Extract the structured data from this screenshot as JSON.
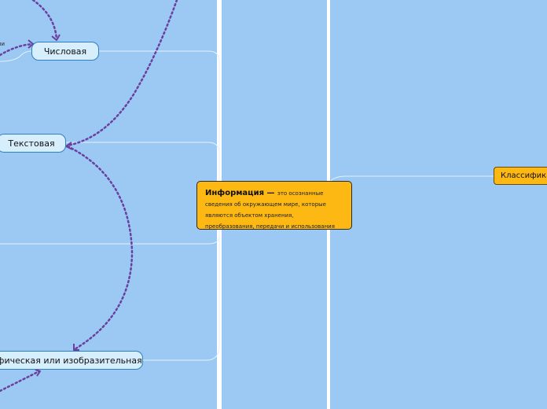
{
  "mindmap": {
    "central": {
      "title": "Информация —",
      "text": "это осознанные сведения об окружающем мире, которые являются объектом хранения, преобразования, передачи и использования"
    },
    "branches": [
      {
        "id": "numeric",
        "label": "Числовая"
      },
      {
        "id": "text",
        "label": "Текстовая"
      },
      {
        "id": "graphic",
        "label": "афическая или изобразительная"
      }
    ],
    "classification": {
      "label": "Классификац"
    },
    "stray_label": "ли"
  },
  "colors": {
    "background": "#9cc9f3",
    "central_fill": "#fdb813",
    "subtopic_fill": "#d7eefd",
    "subtopic_border": "#2f7fc4",
    "relationship": "#6a3fa0",
    "divider": "#ffffff"
  }
}
